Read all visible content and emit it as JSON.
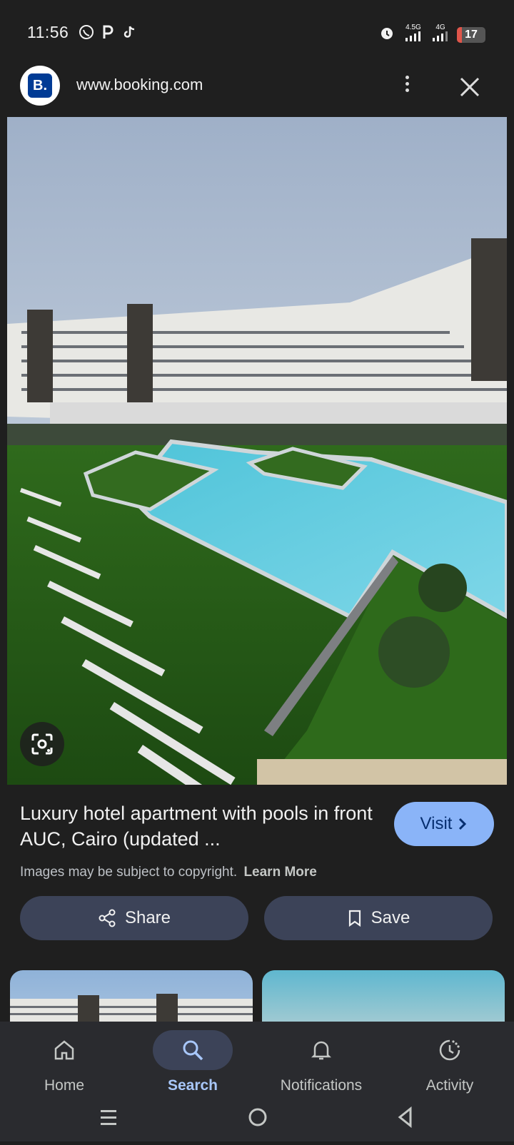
{
  "status": {
    "time": "11:56",
    "network_1": "4.5G",
    "network_2": "4G",
    "battery": "17"
  },
  "browser": {
    "url": "www.booking.com",
    "site_logo_text": "B."
  },
  "result": {
    "title": "Luxury hotel apartment with pools in front AUC, Cairo (updated ...",
    "visit_label": "Visit",
    "copyright_text": "Images may be subject to copyright.",
    "learn_more": "Learn More",
    "share_label": "Share",
    "save_label": "Save"
  },
  "nav": {
    "items": [
      {
        "label": "Home",
        "icon": "home-icon",
        "active": false
      },
      {
        "label": "Search",
        "icon": "search-icon",
        "active": true
      },
      {
        "label": "Notifications",
        "icon": "bell-icon",
        "active": false
      },
      {
        "label": "Activity",
        "icon": "activity-icon",
        "active": false
      }
    ]
  },
  "colors": {
    "background": "#1f1f1f",
    "accent": "#8ab4f8",
    "button_bg": "#3c4358",
    "active_label": "#a8c7fa"
  }
}
